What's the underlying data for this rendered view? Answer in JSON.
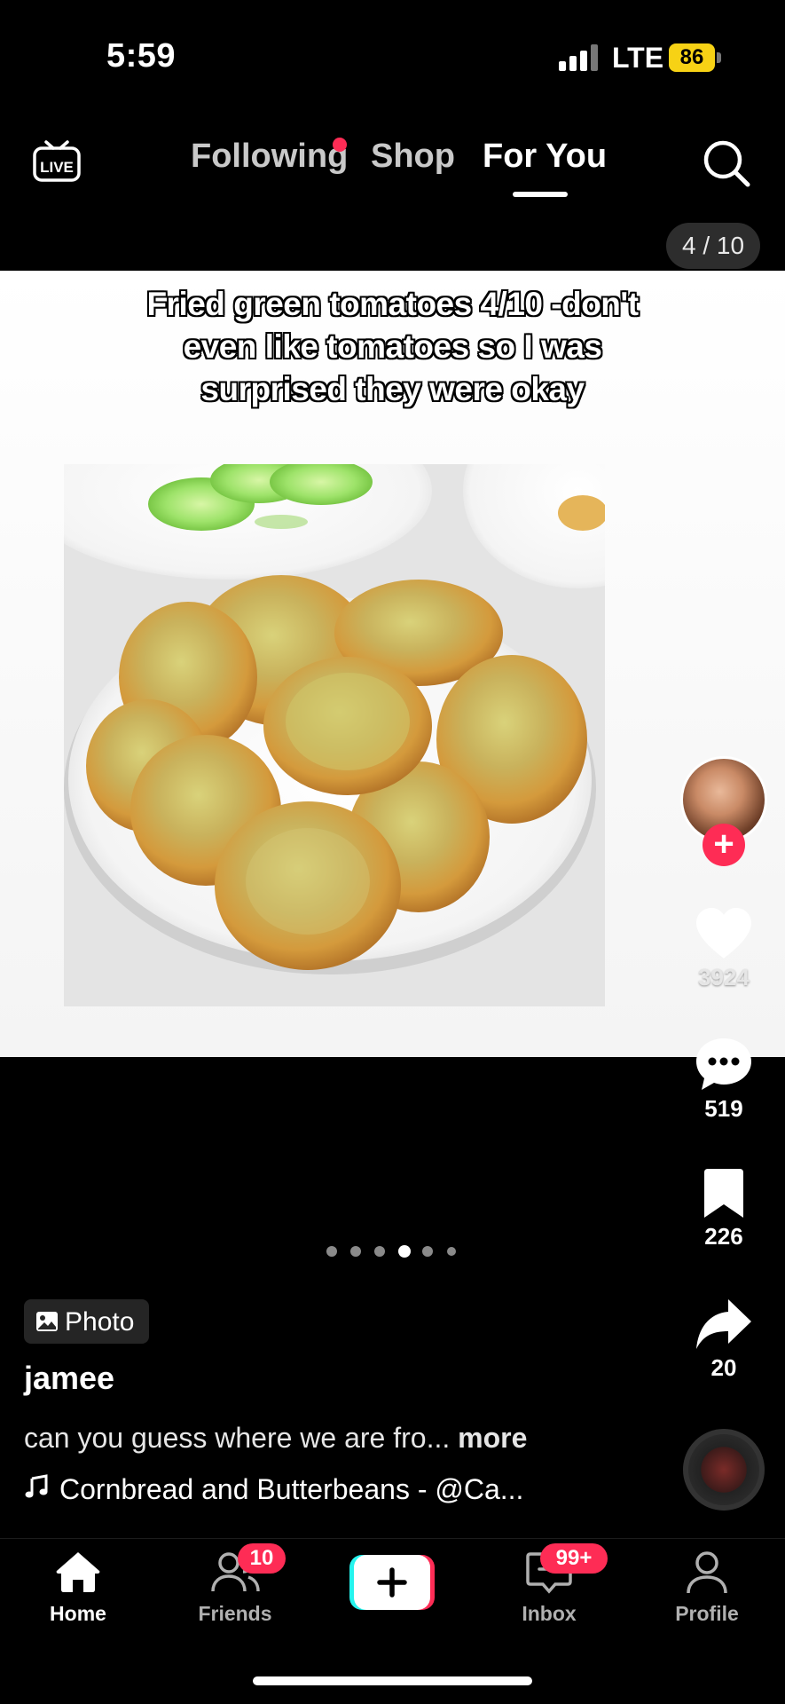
{
  "status_bar": {
    "time": "5:59",
    "network": "LTE",
    "battery": "86",
    "battery_color": "#f7d215"
  },
  "top_nav": {
    "live_icon": "live-tv-icon",
    "tabs": [
      {
        "label": "Following",
        "has_notification_dot": true
      },
      {
        "label": "Shop"
      },
      {
        "label": "For You",
        "active": true
      }
    ],
    "search_icon": "search-icon"
  },
  "post": {
    "slide_counter": "4 / 10",
    "caption": "Fried green tomatoes 4/10 -don't even like tomatoes so I was surprised they were okay",
    "image": "fried-green-tomatoes-photo",
    "pagination": {
      "total_visible": 6,
      "active_index": 3
    },
    "type_badge": "Photo",
    "username": "jamee",
    "description": "can you guess where we are fro...",
    "more_label": "more",
    "sound": "Cornbread and Butterbeans - @Ca..."
  },
  "actions": {
    "likes": "3924",
    "comments": "519",
    "saves": "226",
    "shares": "20"
  },
  "bottom_nav": {
    "items": [
      {
        "label": "Home",
        "icon": "home-icon",
        "active": true
      },
      {
        "label": "Friends",
        "icon": "friends-icon",
        "badge": "10"
      },
      {
        "label": "",
        "icon": "create-plus-icon"
      },
      {
        "label": "Inbox",
        "icon": "inbox-icon",
        "badge": "99+"
      },
      {
        "label": "Profile",
        "icon": "profile-icon"
      }
    ]
  },
  "colors": {
    "accent": "#fe2c55",
    "background": "#000000"
  }
}
